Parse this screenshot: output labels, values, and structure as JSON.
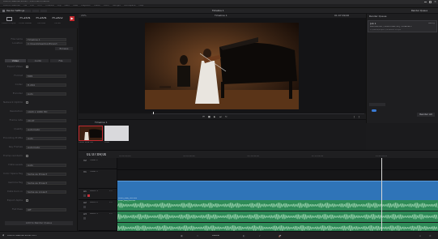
{
  "window": {
    "title": "DaVinci Resolve Studio - Violin Performance"
  },
  "menu": {
    "items": [
      "DaVinci Resolve",
      "File",
      "Edit",
      "Trim",
      "Timeline",
      "Clip",
      "Mark",
      "View",
      "Playback",
      "Fusion",
      "Color",
      "Fairlight",
      "Workspace",
      "Help"
    ]
  },
  "topbar": {
    "left_tab": "Render Settings",
    "center_title": "Timeline 1",
    "right_label": "Render Queue"
  },
  "presets": [
    {
      "name": "H.264",
      "sub": "Custom Export"
    },
    {
      "name": "H.264",
      "sub": "H.264 Master"
    },
    {
      "name": "H.264",
      "sub": "YouTube"
    },
    {
      "name": "H.265",
      "sub": "Vimeo"
    }
  ],
  "render_settings": {
    "filename_label": "File name",
    "filename": "Timeline 1",
    "location_label": "Location",
    "location": "C:\\Users\\Desktop\\Export",
    "browse": "Browse",
    "tabs": [
      "Video",
      "Audio",
      "File"
    ],
    "rows": [
      {
        "label": "Export Video",
        "value": ""
      },
      {
        "label": "Format",
        "value": "MP4"
      },
      {
        "label": "Codec",
        "value": "H.264"
      },
      {
        "label": "Encoder",
        "value": "Auto"
      },
      {
        "label": "Network Optimization",
        "value": ""
      },
      {
        "label": "Resolution",
        "value": "1920 x 1080 HD"
      },
      {
        "label": "Frame rate",
        "value": "29.97"
      },
      {
        "label": "Quality",
        "value": "Automatic"
      },
      {
        "label": "Encoding Profile",
        "value": "Auto"
      },
      {
        "label": "Key Frames",
        "value": "Automatic"
      },
      {
        "label": "Frame reordering",
        "value": ""
      },
      {
        "label": "Data Levels",
        "value": "Auto"
      },
      {
        "label": "Color Space Tag",
        "value": "Same as Project"
      },
      {
        "label": "Gamma Tag",
        "value": "Same as Project"
      },
      {
        "label": "Data burn-in",
        "value": "Same as project"
      },
      {
        "label": "Export Alpha",
        "value": ""
      },
      {
        "label": "Flat Pass",
        "value": "Off"
      }
    ],
    "add_button": "Add to Render Queue"
  },
  "viewer": {
    "zoom": "29%",
    "clip_name": "Timeline 1",
    "timecode": "01:07:09;00",
    "mode": "Entire Timeline"
  },
  "render_queue": {
    "title": "Render Queue",
    "job_title": "Job 1",
    "job_name": "2023-02-03 / Violin Live HD | Timeline 1",
    "job_path": "C:\\Users\\Export\\Timeline 1.mp4",
    "job_status": "Ready",
    "render_all": "Render All"
  },
  "media_pool": {
    "title": "Timeline 1",
    "clips": [
      {
        "name": "Violin Live HD",
        "kind": "video"
      },
      {
        "name": "Title",
        "kind": "blank"
      }
    ]
  },
  "timeline": {
    "timecode": "01:07:09;00",
    "ruler": [
      "01:00:00;00",
      "01:05:00;00",
      "01:10:00;00",
      "01:15:00;00",
      "01:20:00;00"
    ],
    "tracks": [
      {
        "id": "V2",
        "name": "Video 2",
        "clips": ""
      },
      {
        "id": "V1",
        "name": "Video 1",
        "clips": "1 Clip"
      },
      {
        "id": "A1",
        "name": "Audio 1",
        "level": "2.0"
      },
      {
        "id": "A2",
        "name": "Audio 2",
        "level": "2.0"
      },
      {
        "id": "A3",
        "name": "Audio 3",
        "level": "2.0"
      }
    ],
    "video_clip_label": "Violin_Live_HD.mov",
    "audio_clip_label": "Violin_Live_HD.mov",
    "colors": {
      "video": "#2f74b8",
      "audio": "#2e8a57",
      "playhead": "#d8d8d8"
    }
  },
  "status": {
    "app_name": "DaVinci Resolve Studio 18.5",
    "center": "Deliver",
    "right": ""
  }
}
